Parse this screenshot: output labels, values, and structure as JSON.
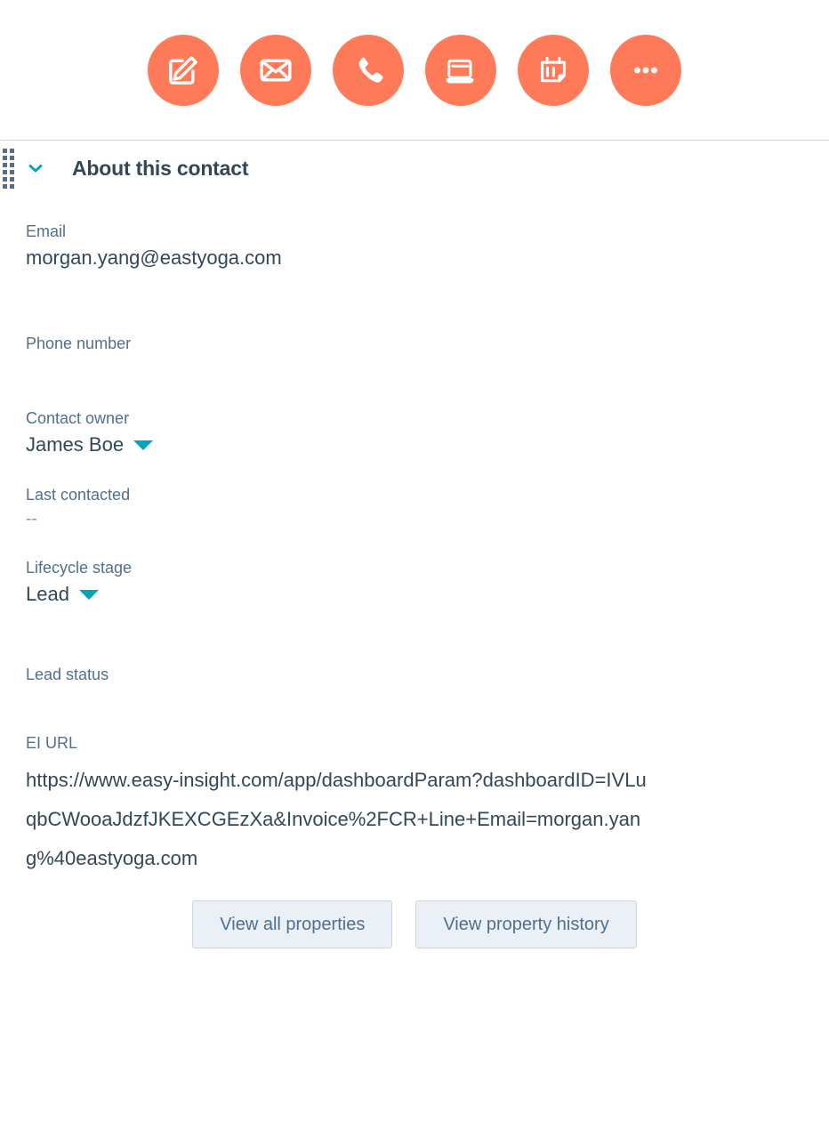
{
  "theme": {
    "accent_orange": "#FF7A59",
    "accent_teal": "#00A4BD",
    "text_dark": "#33475B",
    "text_muted": "#516F90",
    "border": "#CBD6E2",
    "button_bg": "#EAF0F6"
  },
  "action_bar": {
    "items": [
      {
        "icon": "note-edit-icon",
        "label": "Note"
      },
      {
        "icon": "email-envelope-icon",
        "label": "Email"
      },
      {
        "icon": "phone-call-icon",
        "label": "Call"
      },
      {
        "icon": "task-log-icon",
        "label": "Log"
      },
      {
        "icon": "calendar-meeting-icon",
        "label": "Meeting"
      },
      {
        "icon": "ellipsis-more-icon",
        "label": "More"
      }
    ]
  },
  "section": {
    "title": "About this contact",
    "collapse_icon": "chevron-down-icon",
    "drag_icon": "drag-handle-icon",
    "expanded": true
  },
  "properties": [
    {
      "label": "Email",
      "value": "morgan.yang@eastyoga.com",
      "has_dropdown": false,
      "name": "email"
    },
    {
      "label": "Phone number",
      "value": "",
      "has_dropdown": false,
      "name": "phone"
    },
    {
      "label": "Contact owner",
      "value": "James Boe",
      "has_dropdown": true,
      "name": "owner"
    },
    {
      "label": "Last contacted",
      "value": "--",
      "has_dropdown": false,
      "name": "last-contacted"
    },
    {
      "label": "Lifecycle stage",
      "value": "Lead",
      "has_dropdown": true,
      "name": "lifecycle-stage"
    },
    {
      "label": "Lead status",
      "value": "",
      "has_dropdown": false,
      "name": "lead-status"
    },
    {
      "label": "EI URL",
      "value": "https://www.easy-insight.com/app/dashboardParam?dashboardID=IVLuqbCWooaJdzfJKEXCGEzXa&Invoice%2FCR+Line+Email=morgan.yang%40eastyoga.com",
      "has_dropdown": false,
      "name": "ei-url"
    }
  ],
  "footer": {
    "view_all_properties": "View all properties",
    "view_property_history": "View property history"
  }
}
